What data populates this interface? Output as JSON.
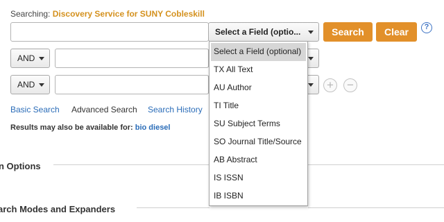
{
  "searching": {
    "label": "Searching:",
    "service": "Discovery Service for SUNY Cobleskill"
  },
  "search_row": {
    "field_select": "Select a Field (optio...",
    "search_button": "Search",
    "clear_button": "Clear",
    "help_icon": "?"
  },
  "row2": {
    "operator": "AND"
  },
  "row3": {
    "operator": "AND",
    "add_icon": "+",
    "remove_icon": "−"
  },
  "links": {
    "basic": "Basic Search",
    "advanced": "Advanced Search",
    "history": "History",
    "search_history": "Search History"
  },
  "results": {
    "prefix": "Results may also be available for:",
    "suggestion": "bio diesel"
  },
  "sections": {
    "options": "n Options",
    "modes": "arch Modes and Expanders"
  },
  "dropdown": {
    "options": [
      "Select a Field (optional)",
      "TX All Text",
      "AU Author",
      "TI Title",
      "SU Subject Terms",
      "SO Journal Title/Source",
      "AB Abstract",
      "IS ISSN",
      "IB ISBN"
    ],
    "selected_index": 0
  },
  "colors": {
    "accent": "#e2902a",
    "link": "#2a6cb8",
    "service": "#d4911e"
  }
}
